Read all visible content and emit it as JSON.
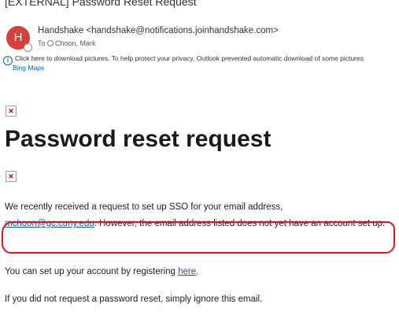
{
  "email": {
    "subject": "[EXTERNAL] Password Reset Request",
    "avatar_initial": "H",
    "sender": "Handshake <handshake@notifications.joinhandshake.com>",
    "to_prefix": "To",
    "to_name": "Choon, Mark",
    "info_icon": "i",
    "info_bar": "Click here to download pictures. To help protect your privacy, Outlook prevented automatic download of some pictures",
    "addin": "Bing Maps"
  },
  "body": {
    "broken_image_glyph": "✕",
    "title": "Password reset request",
    "para1_line1": "We recently received a request to set up SSO for your email address,",
    "para1_email": "mchoon@gc.cuny.edu",
    "para1_rest": ". However, the email address listed does not yet have an account set up.",
    "para2_before": "You can set up your account by registering ",
    "para2_link": "here",
    "para2_after": ".",
    "para3": "If you did not request a password reset, simply ignore this email."
  },
  "colors": {
    "avatar": "#d6403a",
    "link": "#0563c1",
    "visited_link": "#7030a0",
    "annotation": "#e0141e"
  }
}
